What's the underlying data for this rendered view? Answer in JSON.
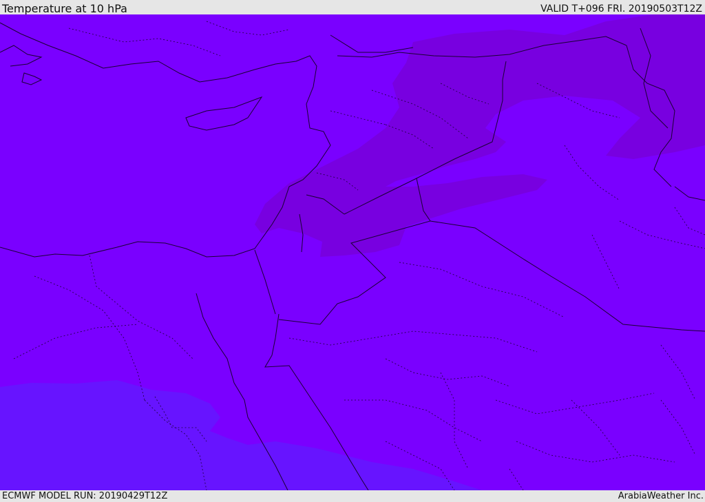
{
  "header": {
    "title": "Temperature at 10 hPa",
    "valid_time": "VALID T+096 FRI. 20190503T12Z"
  },
  "footer": {
    "model_run": "ECMWF MODEL RUN: 20190429T12Z",
    "credit": "ArabiaWeather Inc."
  },
  "map": {
    "field": "temperature",
    "level": "10 hPa",
    "colors": {
      "field_base": "#7a00ff",
      "field_warm": "#7800e0",
      "field_cool": "#6714ff",
      "coastline": "#1a0033",
      "border": "#1a0033"
    }
  }
}
